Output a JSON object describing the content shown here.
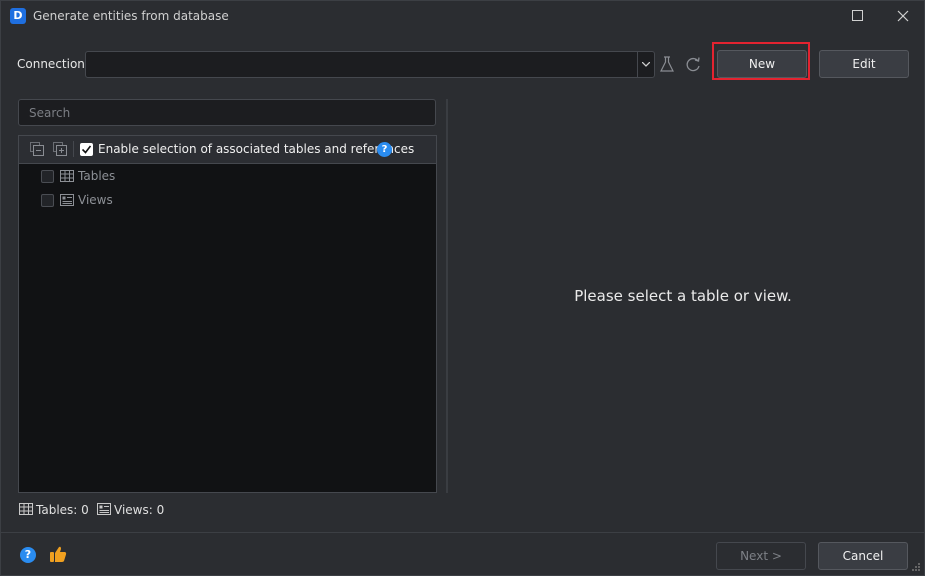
{
  "window": {
    "title": "Generate entities from database",
    "app_icon_letter": "D"
  },
  "connection": {
    "label": "Connection:",
    "value": "",
    "new_label": "New",
    "edit_label": "Edit"
  },
  "search": {
    "placeholder": "Search",
    "value": ""
  },
  "tree": {
    "enable_label": "Enable selection of associated tables and references",
    "enable_checked": true,
    "help_glyph": "?",
    "items": [
      {
        "label": "Tables",
        "icon": "table-icon",
        "checked": false
      },
      {
        "label": "Views",
        "icon": "view-icon",
        "checked": false
      }
    ]
  },
  "details": {
    "placeholder": "Please select a table or view."
  },
  "status": {
    "tables_label": "Tables: 0",
    "views_label": "Views: 0"
  },
  "footer": {
    "help_glyph": "?",
    "next_label": "Next >",
    "cancel_label": "Cancel"
  },
  "colors": {
    "accent": "#2a8cf0",
    "highlight": "#e32330",
    "like": "#f0a020"
  }
}
